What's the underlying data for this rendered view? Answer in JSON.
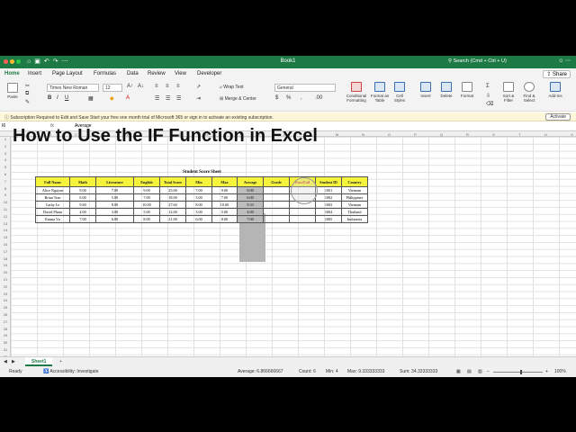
{
  "window": {
    "title": "Book1",
    "search_placeholder": "Search (Cmd + Ctrl + U)",
    "share_label": "Share"
  },
  "tabs": [
    "Home",
    "Insert",
    "Page Layout",
    "Formulas",
    "Data",
    "Review",
    "View",
    "Developer"
  ],
  "ribbon": {
    "paste": "Paste",
    "font_name": "Times New Roman",
    "font_size": "12",
    "wrap_text": "Wrap Text",
    "merge_center": "Merge & Center",
    "number_format": "General",
    "conditional_formatting": "Conditional Formatting",
    "format_as_table": "Format as Table",
    "cell_styles": "Cell Styles",
    "insert": "Insert",
    "delete": "Delete",
    "format": "Format",
    "sort_filter": "Sort & Filter",
    "find_select": "Find & Select",
    "add_ins": "Add-ins"
  },
  "subscription": {
    "message": "Subscription Required to Edit and Save  Start your free one month trial of Microsoft 365 or sign in to activate an existing subscription.",
    "button": "Activate"
  },
  "formula_bar": {
    "name_box": "I6",
    "fx": "fx",
    "content": "Average"
  },
  "columns": [
    "A",
    "B",
    "C",
    "D",
    "E",
    "F",
    "G",
    "H",
    "I",
    "J",
    "K",
    "L",
    "M",
    "N",
    "O",
    "P",
    "Q",
    "R",
    "S",
    "T",
    "U",
    "V"
  ],
  "rows": [
    "1",
    "2",
    "3",
    "4",
    "5",
    "6",
    "7",
    "8",
    "9",
    "10",
    "11",
    "12",
    "13",
    "14",
    "15",
    "16",
    "17",
    "18",
    "19",
    "20",
    "21",
    "22",
    "23",
    "24",
    "25",
    "26",
    "27",
    "28",
    "29",
    "30",
    "31",
    "32",
    "33",
    "34",
    "35",
    "36",
    "37",
    "38"
  ],
  "overlay_title": "How to Use the IF Function in Excel",
  "sheet_title": "Student Score Sheet",
  "table": {
    "headers": [
      "Full Name",
      "Math",
      "Literature",
      "English",
      "Total Score",
      "Min",
      "Max",
      "Average",
      "Grade",
      "Pass/Fail",
      "Student ID",
      "Country"
    ],
    "rows": [
      [
        "Alice Nguyen",
        "9.00",
        "7.00",
        "9.00",
        "25.00",
        "7.00",
        "9.00",
        "8.00",
        "",
        "",
        "1001",
        "Vietnam"
      ],
      [
        "Brian Tran",
        "6.00",
        "5.00",
        "7.00",
        "18.00",
        "5.00",
        "7.00",
        "6.00",
        "",
        "",
        "1002",
        "Philippines"
      ],
      [
        "Cathy Le",
        "9.60",
        "8.00",
        "10.00",
        "27.60",
        "8.00",
        "10.00",
        "9.33",
        "",
        "",
        "1003",
        "Vietnam"
      ],
      [
        "David Pham",
        "4.00",
        "3.00",
        "5.00",
        "12.00",
        "3.00",
        "5.00",
        "4.00",
        "",
        "",
        "1004",
        "Thailand"
      ],
      [
        "Emma Vu",
        "7.00",
        "6.00",
        "8.00",
        "21.00",
        "6.00",
        "8.00",
        "7.00",
        "",
        "",
        "1005",
        "Indonesia"
      ]
    ]
  },
  "sheet_tab": "Sheet1",
  "status": {
    "ready": "Ready",
    "accessibility": "Accessibility: Investigate",
    "average": "Average: 6.866666667",
    "count": "Count: 6",
    "min": "Min: 4",
    "max": "Max: 9.333333333",
    "sum": "Sum: 34.33333333",
    "zoom": "100%"
  },
  "colors": {
    "accent": "#1e7a45",
    "header_fill": "#f5f33c",
    "pass_fail_text": "#c0282d"
  }
}
